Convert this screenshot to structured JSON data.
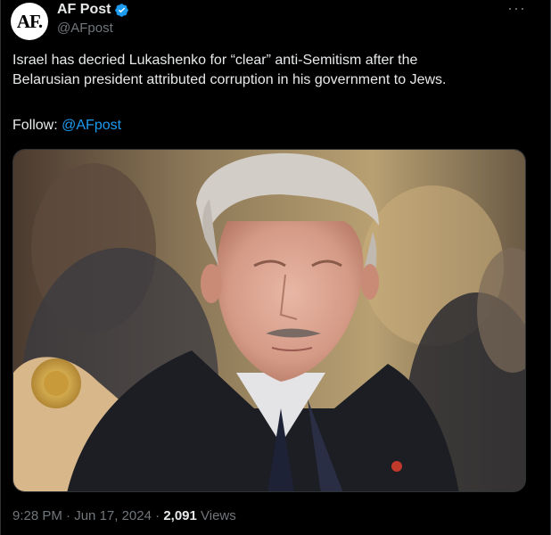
{
  "author": {
    "display_name": "AF Post",
    "handle": "@AFpost",
    "avatar_text": "AF."
  },
  "tweet": {
    "text_line1": "Israel has decried Lukashenko for “clear” anti-Semitism after the",
    "text_line2": "Belarusian president attributed corruption in his government to Jews.",
    "follow_label": "Follow: ",
    "follow_mention": "@AFpost"
  },
  "meta": {
    "time": "9:28 PM",
    "separator1": " · ",
    "date": "Jun 17, 2024",
    "separator2": " · ",
    "views_count": "2,091",
    "views_label": " Views"
  },
  "colors": {
    "background": "#000000",
    "text": "#e7e9ea",
    "secondary": "#71767b",
    "accent": "#1d9bf0"
  }
}
